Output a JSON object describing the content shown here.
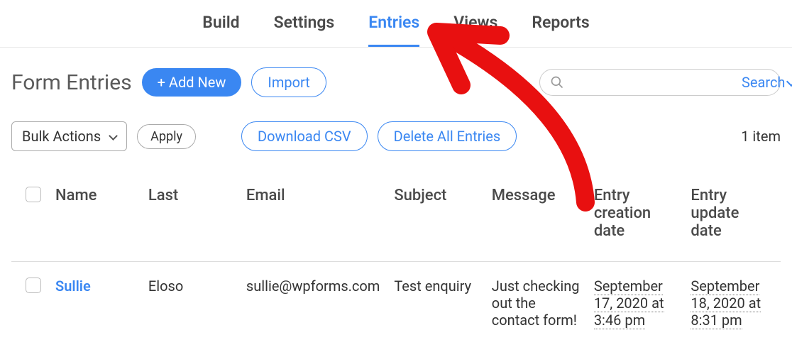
{
  "topnav": {
    "items": [
      {
        "label": "Build",
        "active": false
      },
      {
        "label": "Settings",
        "active": false
      },
      {
        "label": "Entries",
        "active": true
      },
      {
        "label": "Views",
        "active": false
      },
      {
        "label": "Reports",
        "active": false
      }
    ]
  },
  "header": {
    "title": "Form Entries",
    "add_new_prefix": "+",
    "add_new_label": "Add New",
    "import_label": "Import",
    "search": {
      "placeholder": "",
      "dropdown_label": "Search"
    }
  },
  "actions": {
    "bulk_label": "Bulk Actions",
    "apply_label": "Apply",
    "download_csv_label": "Download CSV",
    "delete_all_label": "Delete All Entries",
    "item_count": "1 item"
  },
  "table": {
    "columns": [
      "Name",
      "Last",
      "Email",
      "Subject",
      "Message",
      "Entry creation date",
      "Entry update date"
    ],
    "rows": [
      {
        "name": "Sullie",
        "last": "Eloso",
        "email": "sullie@wpforms.com",
        "subject": "Test enquiry",
        "message": "Just checking out the contact form!",
        "creation": "September 17, 2020 at 3:46 pm",
        "update": "September 18, 2020 at 8:31 pm"
      }
    ]
  },
  "colors": {
    "accent": "#3a87f2",
    "annotation": "#e81010"
  }
}
